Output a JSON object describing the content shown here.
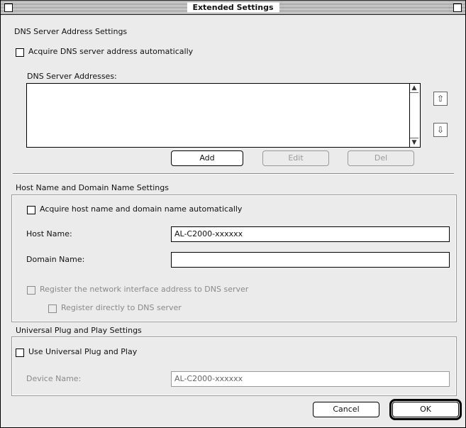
{
  "window": {
    "title": "Extended Settings"
  },
  "dns": {
    "section_label": "DNS Server Address Settings",
    "auto_checkbox_label": "Acquire DNS server address automatically",
    "auto_checked": false,
    "list_label": "DNS Server Addresses:",
    "list_items": [],
    "add_button": "Add",
    "edit_button": "Edit",
    "delete_button": "Del"
  },
  "hostname": {
    "section_label": "Host Name and Domain Name Settings",
    "auto_checkbox_label": "Acquire host name and domain name automatically",
    "auto_checked": false,
    "host_name_label": "Host Name:",
    "host_name_value": "AL-C2000-xxxxxx",
    "domain_name_label": "Domain Name:",
    "domain_name_value": "",
    "register_label": "Register the network interface address to DNS server",
    "register_checked": false,
    "register_directly_label": "Register directly to DNS server",
    "register_directly_checked": false
  },
  "upnp": {
    "section_label": "Universal Plug and Play Settings",
    "use_checkbox_label": "Use Universal Plug and Play",
    "use_checked": false,
    "device_name_label": "Device Name:",
    "device_name_value": "AL-C2000-xxxxxx"
  },
  "buttons": {
    "cancel": "Cancel",
    "ok": "OK"
  },
  "colors": {
    "background": "#ebebeb",
    "frame": "#000000",
    "disabled_text": "#8a8a8a"
  },
  "icons": {
    "up": "up-arrow-icon",
    "down": "down-arrow-icon"
  }
}
